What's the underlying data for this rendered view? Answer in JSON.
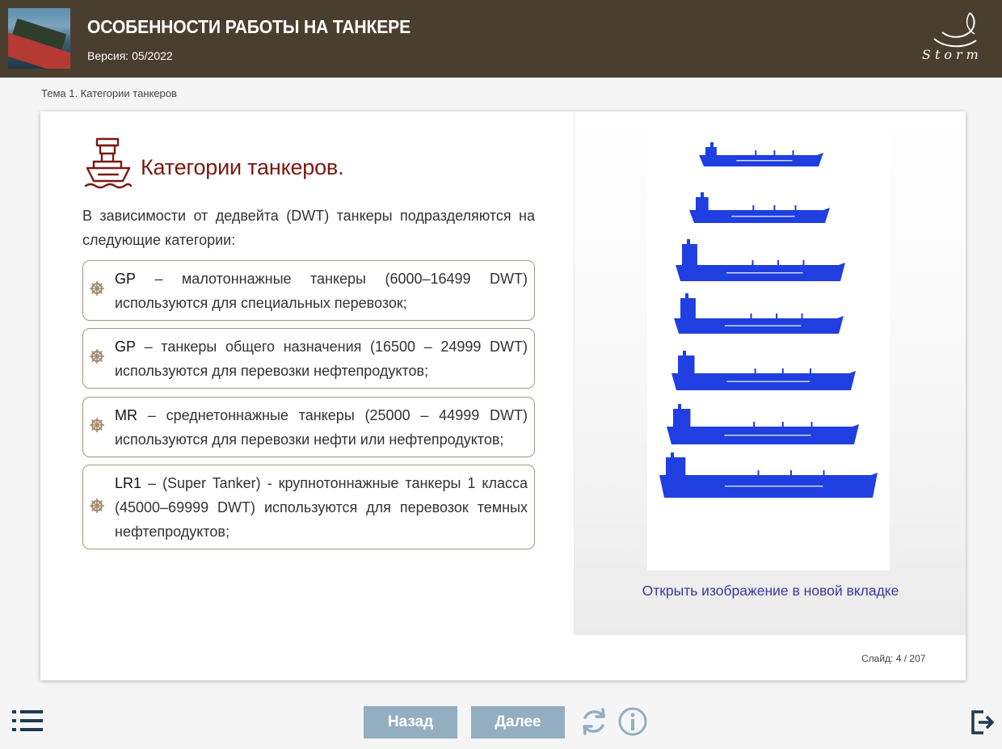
{
  "header": {
    "title": "ОСОБЕННОСТИ РАБОТЫ НА ТАНКЕРЕ",
    "version": "Версия: 05/2022",
    "logo_text": "Storm"
  },
  "breadcrumb": "Тема 1. Категории танкеров",
  "slide": {
    "heading": "Категории танкеров.",
    "intro": "В зависимости от дедвейта (DWT) танкеры подразделяются на следующие категории:",
    "categories": [
      {
        "code": "GP",
        "text": " – малотоннажные танкеры (6000–16499 DWT) используются для специальных перевозок;"
      },
      {
        "code": "GP",
        "text": " – танкеры общего назначения (16500 – 24999 DWT) используются для перевозки нефтепродуктов;"
      },
      {
        "code": "MR",
        "text": " – среднетоннажные танкеры (25000 – 44999 DWT) используются для перевозки нефти или нефтепродуктов;"
      },
      {
        "code": "LR1",
        "text": " – (Super Tanker) - крупнотоннажные танкеры 1 класса (45000–69999 DWT) используются для перевозок темных нефтепродуктов;"
      }
    ],
    "image_link": "Открыть изображение в новой вкладке",
    "ship_color": "#1f3fe0",
    "counter": "Слайд:  4 / 207"
  },
  "nav": {
    "back_label": "Назад",
    "next_label": "Далее",
    "button_color": "#93aec1"
  },
  "icons": {
    "menu": "list-menu-icon",
    "reload": "reload-icon",
    "info": "info-icon",
    "exit": "exit-icon",
    "bullet": "ship-wheel-icon",
    "heading": "tanker-ship-icon"
  }
}
